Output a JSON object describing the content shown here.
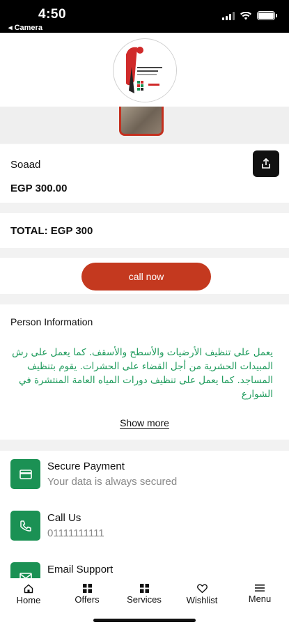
{
  "status_bar": {
    "time": "4:50",
    "back_label": "◂ Camera"
  },
  "product": {
    "name": "Soaad",
    "price": "EGP 300.00"
  },
  "total": {
    "label": "TOTAL: EGP 300"
  },
  "actions": {
    "call_label": "call now"
  },
  "person_info": {
    "title": "Person Information",
    "description": "يعمل على تنظيف الأرضيات والأسطح والأسقف. كما يعمل على رش المبيدات الحشرية من أجل القضاء على الحشرات. يقوم بتنظيف المساجد. كما يعمل على تنظيف دورات المياه العامة المنتشرة في الشوارع",
    "show_more_label": "Show more"
  },
  "features": [
    {
      "title": "Secure Payment",
      "subtitle": "Your data is always secured",
      "icon": "card-icon"
    },
    {
      "title": "Call Us",
      "subtitle": "01111111111",
      "icon": "phone-icon"
    },
    {
      "title": "Email Support",
      "subtitle": "",
      "icon": "mail-icon"
    }
  ],
  "bottom_nav": [
    {
      "label": "Home",
      "icon": "home-icon"
    },
    {
      "label": "Offers",
      "icon": "grid-icon"
    },
    {
      "label": "Services",
      "icon": "grid-icon"
    },
    {
      "label": "Wishlist",
      "icon": "heart-icon"
    },
    {
      "label": "Menu",
      "icon": "hamburger-icon"
    }
  ],
  "colors": {
    "accent_red": "#c4391f",
    "accent_green": "#1b9154",
    "text_green": "#1d9a5b"
  }
}
